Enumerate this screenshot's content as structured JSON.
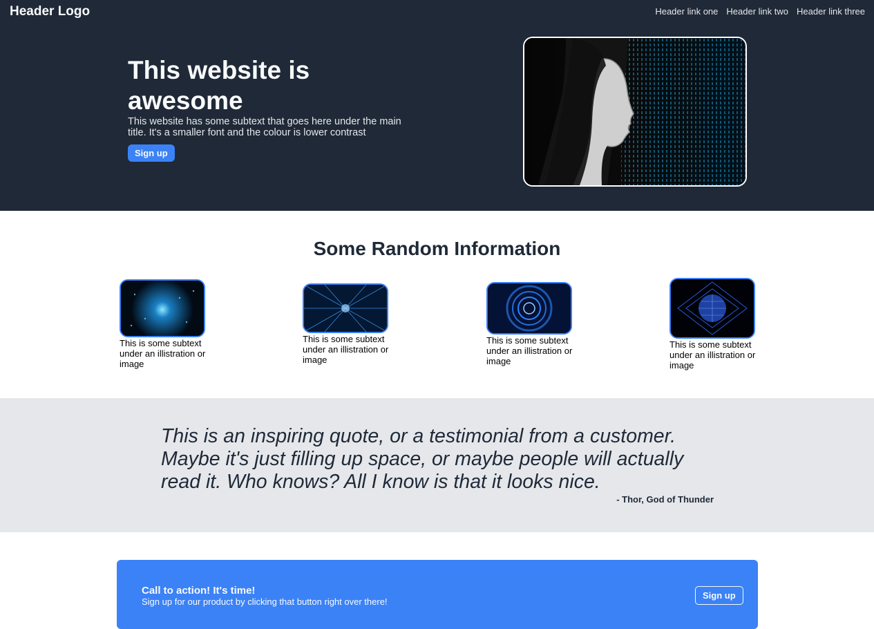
{
  "header": {
    "logo": "Header Logo",
    "links": [
      "Header link one",
      "Header link two",
      "Header link three"
    ]
  },
  "hero": {
    "title": "This website is awesome",
    "subtext": "This website has some subtext that goes here under the main title. It's a smaller font and the colour is lower contrast",
    "button_label": "Sign up",
    "image_icon": "woman-profile-binary-code-image"
  },
  "info": {
    "title": "Some Random Information",
    "cards": [
      {
        "text": "This is some subtext under an illistration or image",
        "image": "particle-network-image"
      },
      {
        "text": "This is some subtext under an illistration or image",
        "image": "data-tunnel-image"
      },
      {
        "text": "This is some subtext under an illistration or image",
        "image": "circular-tech-image"
      },
      {
        "text": "This is some subtext under an illistration or image",
        "image": "digital-sphere-image"
      }
    ]
  },
  "quote": {
    "text": "This is an inspiring quote, or a testimonial from a customer. Maybe it's just filling up space, or maybe people will actually read it. Who knows? All I know is that it looks nice.",
    "author": "- Thor, God of Thunder"
  },
  "cta": {
    "title": "Call to action! It's time!",
    "subtext": "Sign up for our product by clicking that button right over there!",
    "button_label": "Sign up"
  },
  "colors": {
    "hero_bg": "#1f2937",
    "accent": "#3b82f6",
    "quote_bg": "#e5e7eb"
  }
}
